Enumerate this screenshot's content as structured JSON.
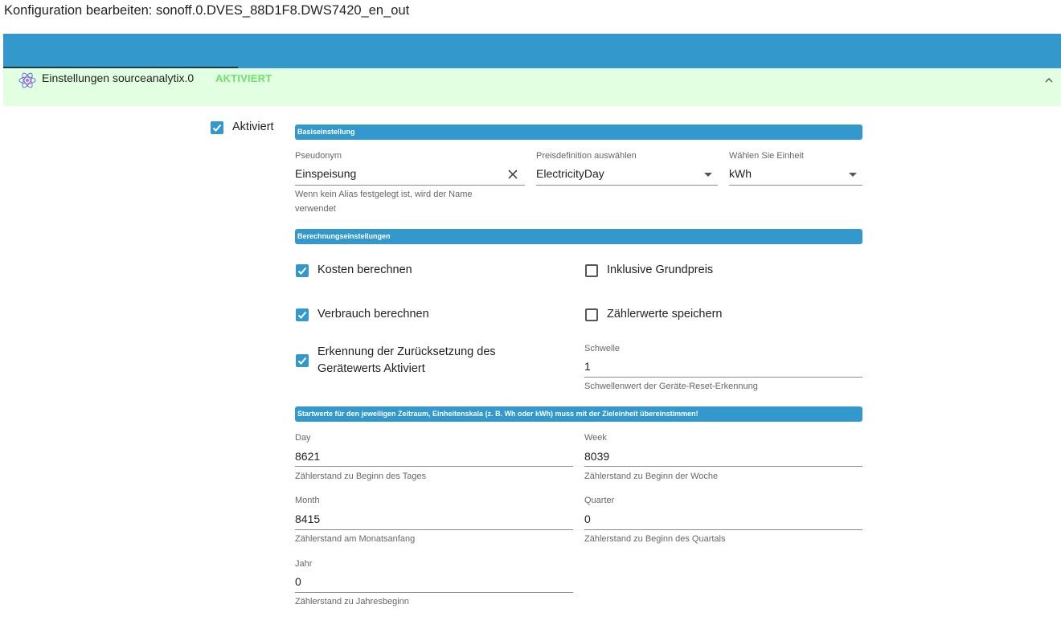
{
  "window": {
    "title": "Konfiguration bearbeiten: sonoff.0.DVES_88D1F8.DWS7420_en_out"
  },
  "panel": {
    "label": "Einstellungen sourceanalytix.0",
    "status": "AKTIVIERT",
    "icon": "atom-icon",
    "status_color": "#6ce36c",
    "bg_color": "#e2ffe2"
  },
  "main_toggle": {
    "label": "Aktiviert",
    "checked": true
  },
  "accent": "#3399cc",
  "sections": {
    "basic": "Basiseinstellung",
    "calc": "Berechnungseinstellungen",
    "start": "Startwerte für den jeweiligen Zeitraum, Einheitenskala (z. B. Wh oder kWh) muss mit der Zieleinheit übereinstimmen!"
  },
  "basic": {
    "alias": {
      "label": "Pseudonym",
      "value": "Einspeisung",
      "help": "Wenn kein Alias festgelegt ist, wird der Name verwendet"
    },
    "price": {
      "label": "Preisdefinition auswählen",
      "value": "ElectricityDay"
    },
    "unit": {
      "label": "Wählen Sie Einheit",
      "value": "kWh"
    }
  },
  "calc": {
    "costs": {
      "label": "Kosten berechnen",
      "checked": true
    },
    "base_price": {
      "label": "Inklusive Grundpreis",
      "checked": false
    },
    "consumption": {
      "label": "Verbrauch berechnen",
      "checked": true
    },
    "save_meter": {
      "label": "Zählerwerte speichern",
      "checked": false
    },
    "reset_detect": {
      "label": "Erkennung der Zurücksetzung des Gerätewerts Aktiviert",
      "checked": true
    },
    "threshold": {
      "label": "Schwelle",
      "value": "1",
      "help": "Schwellenwert der Geräte-Reset-Erkennung"
    }
  },
  "start": {
    "day": {
      "label": "Day",
      "value": "8621",
      "help": "Zählerstand zu Beginn des Tages"
    },
    "week": {
      "label": "Week",
      "value": "8039",
      "help": "Zählerstand zu Beginn der Woche"
    },
    "month": {
      "label": "Month",
      "value": "8415",
      "help": "Zählerstand am Monatsanfang"
    },
    "quarter": {
      "label": "Quarter",
      "value": "0",
      "help": "Zählerstand zu Beginn des Quartals"
    },
    "year": {
      "label": "Jahr",
      "value": "0",
      "help": "Zählerstand zu Jahresbeginn"
    }
  }
}
